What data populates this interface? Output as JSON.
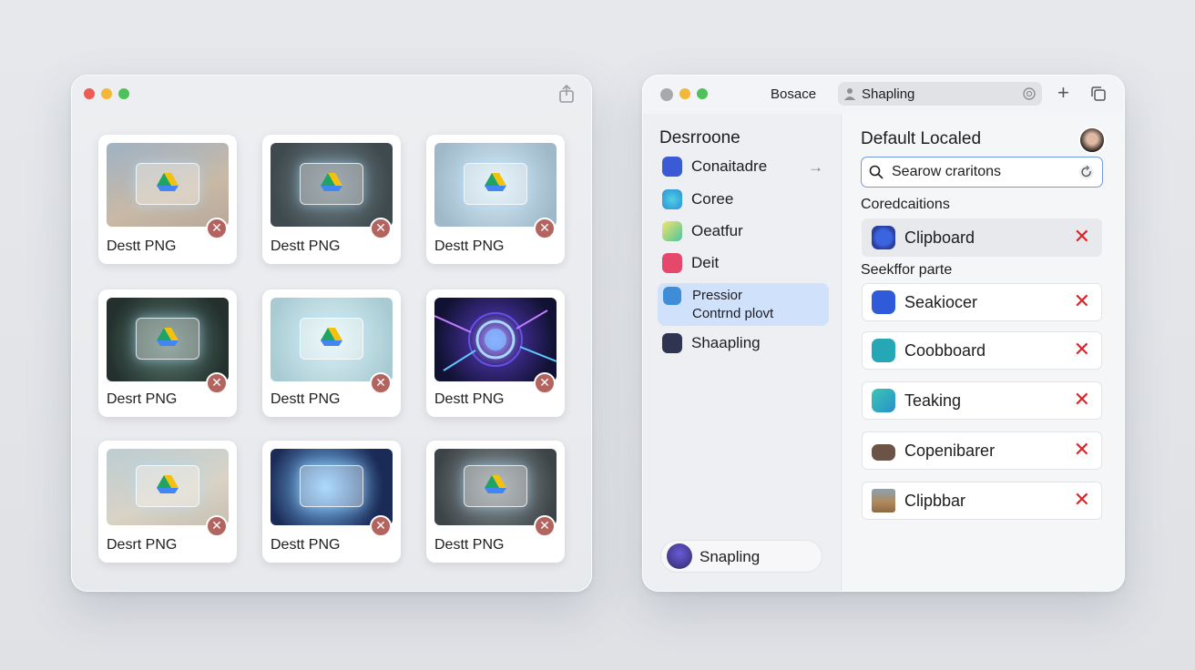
{
  "left_window": {
    "cards": [
      {
        "label": "Destt PNG"
      },
      {
        "label": "Destt PNG"
      },
      {
        "label": "Destt PNG"
      },
      {
        "label": "Desrt PNG"
      },
      {
        "label": "Destt PNG"
      },
      {
        "label": "Destt PNG"
      },
      {
        "label": "Desrt PNG"
      },
      {
        "label": "Destt PNG"
      },
      {
        "label": "Destt PNG"
      }
    ],
    "delete_glyph": "✕"
  },
  "right_window": {
    "tab_label": "Bosace",
    "address_text": "Shapling",
    "sidebar": {
      "heading": "Desrroone",
      "items": [
        {
          "label": "Conaitadre",
          "icon": "document-icon",
          "color": "#3b5bd6"
        },
        {
          "label": "Coree",
          "icon": "globe-icon",
          "color": "#39b6d8"
        },
        {
          "label": "Oeatfur",
          "icon": "folder-icon",
          "color": "#4cc3a0"
        },
        {
          "label": "Deit",
          "icon": "target-icon",
          "color": "#e5486b"
        },
        {
          "label": "Pressior",
          "label2": "Contrnd plovt",
          "icon": "s-icon",
          "color": "#3f8cd9"
        },
        {
          "label": "Shaapling",
          "icon": "stack-icon",
          "color": "#2f3550"
        }
      ],
      "user_label": "Snapling"
    },
    "content": {
      "title": "Default Localed",
      "search_text": "Searow craritons",
      "section1": "Coredcaitions",
      "section2": "Seekffor parte",
      "rows": [
        {
          "label": "Clipboard",
          "icon": "clipboard-icon",
          "color": "#3056d3"
        },
        {
          "label": "Seakiocer",
          "icon": "s-app-icon",
          "color": "#2f5ad9"
        },
        {
          "label": "Coobboard",
          "icon": "s-app-icon",
          "color": "#25a7b5"
        },
        {
          "label": "Teaking",
          "icon": "square-app-icon",
          "color": "#2fb6a6"
        },
        {
          "label": "Copenibarer",
          "icon": "camera-icon",
          "color": "#6b5446"
        },
        {
          "label": "Clipbbar",
          "icon": "photo-icon",
          "color": "#b08a5c"
        }
      ],
      "remove_glyph": "✕"
    }
  }
}
